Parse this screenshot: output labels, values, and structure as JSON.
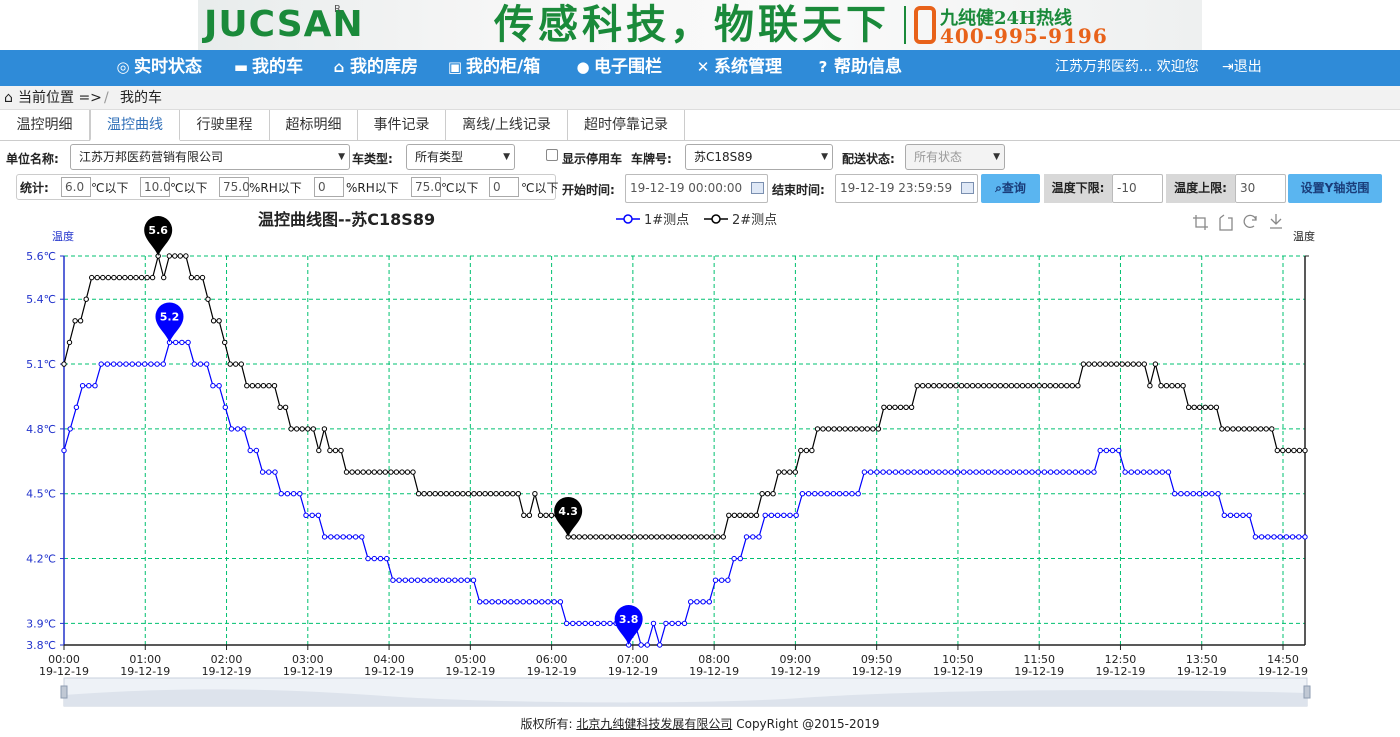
{
  "banner": {
    "logo": "JUCSAN",
    "logo_mark": "R",
    "slogan": "传感科技，物联天下",
    "hotline_label": "九纯健24H热线",
    "hotline_number": "400-995-9196"
  },
  "nav": {
    "items": [
      {
        "icon": "speedometer-icon",
        "glyph": "◎",
        "label": "实时状态"
      },
      {
        "icon": "car-icon",
        "glyph": "▬",
        "label": "我的车"
      },
      {
        "icon": "home-icon",
        "glyph": "⌂",
        "label": "我的库房"
      },
      {
        "icon": "box-icon",
        "glyph": "▣",
        "label": "我的柜/箱"
      },
      {
        "icon": "map-marker-icon",
        "glyph": "●",
        "label": "电子围栏"
      },
      {
        "icon": "tools-icon",
        "glyph": "✕",
        "label": "系统管理"
      },
      {
        "icon": "help-icon",
        "glyph": "?",
        "label": "帮助信息"
      }
    ],
    "user": "江苏万邦医药... 欢迎您",
    "logout": "退出"
  },
  "breadcrumb": {
    "label": "当前位置 =>",
    "sep": "/",
    "current": "我的车"
  },
  "tabs": [
    "温控明细",
    "温控曲线",
    "行驶里程",
    "超标明细",
    "事件记录",
    "离线/上线记录",
    "超时停靠记录"
  ],
  "active_tab": 1,
  "filters": {
    "unit_label": "单位名称:",
    "unit_value": "江苏万邦医药营销有限公司",
    "car_type_label": "车类型:",
    "car_type_value": "所有类型",
    "show_disabled_label": "显示停用车",
    "plate_label": "车牌号:",
    "plate_value": "苏C18S89",
    "delivery_label": "配送状态:",
    "delivery_value": "所有状态",
    "start_label": "开始时间:",
    "start_value": "19-12-19 00:00:00",
    "end_label": "结束时间:",
    "end_value": "19-12-19 23:59:59",
    "query_label": "查询",
    "temp_low_label": "温度下限:",
    "temp_low_value": "-10",
    "temp_high_label": "温度上限:",
    "temp_high_value": "30",
    "set_y_label": "设置Y轴范围"
  },
  "stats": {
    "label": "统计:",
    "fields": [
      {
        "value": "6.0",
        "unit": "℃以下"
      },
      {
        "value": "10.0",
        "unit": "℃以下"
      },
      {
        "value": "75.0",
        "unit": "%RH以下"
      },
      {
        "value": "0",
        "unit": "%RH以下"
      },
      {
        "value": "75.0",
        "unit": "℃以下"
      },
      {
        "value": "0",
        "unit": "℃以下"
      }
    ]
  },
  "colors": {
    "nav": "#2f8bd8",
    "series1": "#0000ff",
    "series2": "#000000",
    "grid": "#00c070",
    "accent": "#5ab5f0"
  },
  "chart_data": {
    "type": "line",
    "title": "温控曲线图--苏C18S89",
    "ylabel": "温度",
    "ylabel_right": "温度",
    "ylim": [
      3.8,
      5.6
    ],
    "yticks": [
      "3.8℃",
      "3.9℃",
      "4.2℃",
      "4.5℃",
      "4.8℃",
      "5.1℃",
      "5.4℃",
      "5.6℃"
    ],
    "ytick_values": [
      3.8,
      3.9,
      4.2,
      4.5,
      4.8,
      5.1,
      5.4,
      5.6
    ],
    "xticks": [
      {
        "time": "00:00",
        "date": "19-12-19"
      },
      {
        "time": "01:00",
        "date": "19-12-19"
      },
      {
        "time": "02:00",
        "date": "19-12-19"
      },
      {
        "time": "03:00",
        "date": "19-12-19"
      },
      {
        "time": "04:00",
        "date": "19-12-19"
      },
      {
        "time": "05:00",
        "date": "19-12-19"
      },
      {
        "time": "06:00",
        "date": "19-12-19"
      },
      {
        "time": "07:00",
        "date": "19-12-19"
      },
      {
        "time": "08:00",
        "date": "19-12-19"
      },
      {
        "time": "09:00",
        "date": "19-12-19"
      },
      {
        "time": "09:50",
        "date": "19-12-19"
      },
      {
        "time": "10:50",
        "date": "19-12-19"
      },
      {
        "time": "11:50",
        "date": "19-12-19"
      },
      {
        "time": "12:50",
        "date": "19-12-19"
      },
      {
        "time": "13:50",
        "date": "19-12-19"
      },
      {
        "time": "14:50",
        "date": "19-12-19"
      }
    ],
    "series": [
      {
        "name": "1#测点",
        "color": "#0000ff",
        "max_label": "5.2",
        "min_label": "3.8",
        "values": [
          4.7,
          4.8,
          4.9,
          5.0,
          5.0,
          5.0,
          5.1,
          5.1,
          5.1,
          5.1,
          5.1,
          5.1,
          5.1,
          5.1,
          5.1,
          5.1,
          5.1,
          5.2,
          5.2,
          5.2,
          5.2,
          5.1,
          5.1,
          5.1,
          5.0,
          5.0,
          4.9,
          4.8,
          4.8,
          4.8,
          4.7,
          4.7,
          4.6,
          4.6,
          4.6,
          4.5,
          4.5,
          4.5,
          4.5,
          4.4,
          4.4,
          4.4,
          4.3,
          4.3,
          4.3,
          4.3,
          4.3,
          4.3,
          4.3,
          4.2,
          4.2,
          4.2,
          4.2,
          4.1,
          4.1,
          4.1,
          4.1,
          4.1,
          4.1,
          4.1,
          4.1,
          4.1,
          4.1,
          4.1,
          4.1,
          4.1,
          4.1,
          4.0,
          4.0,
          4.0,
          4.0,
          4.0,
          4.0,
          4.0,
          4.0,
          4.0,
          4.0,
          4.0,
          4.0,
          4.0,
          4.0,
          3.9,
          3.9,
          3.9,
          3.9,
          3.9,
          3.9,
          3.9,
          3.9,
          3.9,
          3.9,
          3.8,
          3.9,
          3.8,
          3.8,
          3.9,
          3.8,
          3.9,
          3.9,
          3.9,
          3.9,
          4.0,
          4.0,
          4.0,
          4.0,
          4.1,
          4.1,
          4.1,
          4.2,
          4.2,
          4.3,
          4.3,
          4.3,
          4.4,
          4.4,
          4.4,
          4.4,
          4.4,
          4.4,
          4.5,
          4.5,
          4.5,
          4.5,
          4.5,
          4.5,
          4.5,
          4.5,
          4.5,
          4.5,
          4.6,
          4.6,
          4.6,
          4.6,
          4.6,
          4.6,
          4.6,
          4.6,
          4.6,
          4.6,
          4.6,
          4.6,
          4.6,
          4.6,
          4.6,
          4.6,
          4.6,
          4.6,
          4.6,
          4.6,
          4.6,
          4.6,
          4.6,
          4.6,
          4.6,
          4.6,
          4.6,
          4.6,
          4.6,
          4.6,
          4.6,
          4.6,
          4.6,
          4.6,
          4.6,
          4.6,
          4.6,
          4.6,
          4.7,
          4.7,
          4.7,
          4.7,
          4.6,
          4.6,
          4.6,
          4.6,
          4.6,
          4.6,
          4.6,
          4.6,
          4.5,
          4.5,
          4.5,
          4.5,
          4.5,
          4.5,
          4.5,
          4.5,
          4.4,
          4.4,
          4.4,
          4.4,
          4.4,
          4.3,
          4.3,
          4.3,
          4.3,
          4.3,
          4.3,
          4.3,
          4.3,
          4.3
        ]
      },
      {
        "name": "2#测点",
        "color": "#000000",
        "max_label": "5.6",
        "min_label": "4.3",
        "values": [
          5.1,
          5.2,
          5.3,
          5.3,
          5.4,
          5.5,
          5.5,
          5.5,
          5.5,
          5.5,
          5.5,
          5.5,
          5.5,
          5.5,
          5.5,
          5.5,
          5.5,
          5.6,
          5.5,
          5.6,
          5.6,
          5.6,
          5.6,
          5.5,
          5.5,
          5.5,
          5.4,
          5.3,
          5.3,
          5.2,
          5.1,
          5.1,
          5.1,
          5.0,
          5.0,
          5.0,
          5.0,
          5.0,
          5.0,
          4.9,
          4.9,
          4.8,
          4.8,
          4.8,
          4.8,
          4.8,
          4.7,
          4.8,
          4.7,
          4.7,
          4.7,
          4.6,
          4.6,
          4.6,
          4.6,
          4.6,
          4.6,
          4.6,
          4.6,
          4.6,
          4.6,
          4.6,
          4.6,
          4.6,
          4.5,
          4.5,
          4.5,
          4.5,
          4.5,
          4.5,
          4.5,
          4.5,
          4.5,
          4.5,
          4.5,
          4.5,
          4.5,
          4.5,
          4.5,
          4.5,
          4.5,
          4.5,
          4.5,
          4.4,
          4.4,
          4.5,
          4.4,
          4.4,
          4.4,
          4.4,
          4.4,
          4.3,
          4.3,
          4.3,
          4.3,
          4.3,
          4.3,
          4.3,
          4.3,
          4.3,
          4.3,
          4.3,
          4.3,
          4.3,
          4.3,
          4.3,
          4.3,
          4.3,
          4.3,
          4.3,
          4.3,
          4.3,
          4.3,
          4.3,
          4.3,
          4.3,
          4.3,
          4.3,
          4.3,
          4.3,
          4.4,
          4.4,
          4.4,
          4.4,
          4.4,
          4.4,
          4.5,
          4.5,
          4.5,
          4.6,
          4.6,
          4.6,
          4.6,
          4.7,
          4.7,
          4.7,
          4.8,
          4.8,
          4.8,
          4.8,
          4.8,
          4.8,
          4.8,
          4.8,
          4.8,
          4.8,
          4.8,
          4.8,
          4.9,
          4.9,
          4.9,
          4.9,
          4.9,
          4.9,
          5.0,
          5.0,
          5.0,
          5.0,
          5.0,
          5.0,
          5.0,
          5.0,
          5.0,
          5.0,
          5.0,
          5.0,
          5.0,
          5.0,
          5.0,
          5.0,
          5.0,
          5.0,
          5.0,
          5.0,
          5.0,
          5.0,
          5.0,
          5.0,
          5.0,
          5.0,
          5.0,
          5.0,
          5.0,
          5.0,
          5.1,
          5.1,
          5.1,
          5.1,
          5.1,
          5.1,
          5.1,
          5.1,
          5.1,
          5.1,
          5.1,
          5.1,
          5.0,
          5.1,
          5.0,
          5.0,
          5.0,
          5.0,
          5.0,
          4.9,
          4.9,
          4.9,
          4.9,
          4.9,
          4.9,
          4.8,
          4.8,
          4.8,
          4.8,
          4.8,
          4.8,
          4.8,
          4.8,
          4.8,
          4.8,
          4.7,
          4.7,
          4.7,
          4.7,
          4.7,
          4.7
        ]
      }
    ],
    "legend_position": "top-right",
    "grid": true,
    "toolbox": [
      "zoom-icon",
      "zoom-reset-icon",
      "refresh-icon",
      "download-icon"
    ]
  },
  "footer": {
    "prefix": "版权所有:",
    "company": "北京九纯健科技发展有限公司",
    "copyright": "CopyRight @2015-2019"
  }
}
